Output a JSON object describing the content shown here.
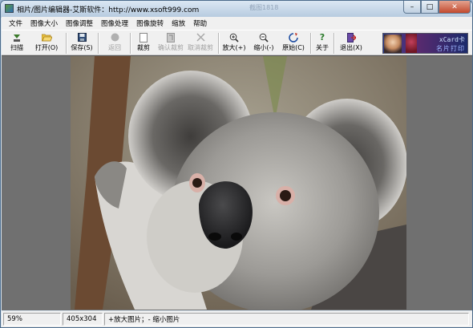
{
  "window": {
    "title": "相片/图片编辑器-艾斯软件：http://www.xsoft999.com",
    "ghost_tab": "截图1818"
  },
  "menu": [
    "文件",
    "图像大小",
    "图像调整",
    "图像处理",
    "图像旋转",
    "缩放",
    "帮助"
  ],
  "toolbar": {
    "scan": "扫描",
    "open": "打开(O)",
    "save": "保存(S)",
    "back": "返回",
    "crop": "裁剪",
    "confirm_crop": "确认裁剪",
    "cancel_crop": "取消裁剪",
    "zoom_in": "放大(+)",
    "zoom_out": "缩小(-)",
    "original": "原始(C)",
    "about": "关于",
    "exit": "退出(X)"
  },
  "banner": {
    "brand": "xCard卡",
    "sub": "名片打印"
  },
  "statusbar": {
    "zoom": "59%",
    "size": "405x304",
    "hint": "+放大图片；- 缩小图片"
  },
  "colors": {
    "canvas_bg": "#707070",
    "chrome": "#f0f0f0",
    "close_btn": "#c34a2e"
  },
  "icons": {
    "scan": "scanner-icon",
    "open": "folder-open-icon",
    "save": "floppy-disk-icon",
    "back": "back-circle-icon",
    "crop": "crop-icon",
    "confirm_crop": "confirm-crop-icon",
    "cancel_crop": "cancel-x-icon",
    "zoom_in": "zoom-in-icon",
    "zoom_out": "zoom-out-icon",
    "original": "original-size-icon",
    "about": "question-icon",
    "exit": "exit-icon"
  }
}
